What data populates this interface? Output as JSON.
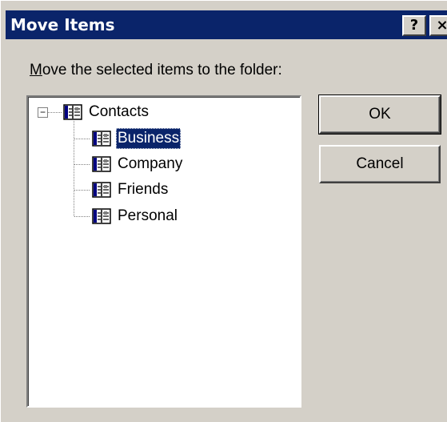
{
  "window": {
    "title": "Move Items",
    "help_button": "?",
    "close_button": "×"
  },
  "prompt": {
    "accelerator": "M",
    "rest": "ove the selected items to the folder:"
  },
  "tree": {
    "root": {
      "label": "Contacts",
      "expander": "−",
      "icon": "address-book-icon",
      "expanded": true
    },
    "children": [
      {
        "label": "Business",
        "icon": "address-book-icon",
        "selected": true
      },
      {
        "label": "Company",
        "icon": "address-book-icon",
        "selected": false
      },
      {
        "label": "Friends",
        "icon": "address-book-icon",
        "selected": false
      },
      {
        "label": "Personal",
        "icon": "address-book-icon",
        "selected": false
      }
    ]
  },
  "buttons": {
    "ok": "OK",
    "cancel": "Cancel"
  },
  "colors": {
    "titlebar": "#0a246a",
    "dialog_face": "#d4d0c8",
    "selection": "#0a246a"
  }
}
